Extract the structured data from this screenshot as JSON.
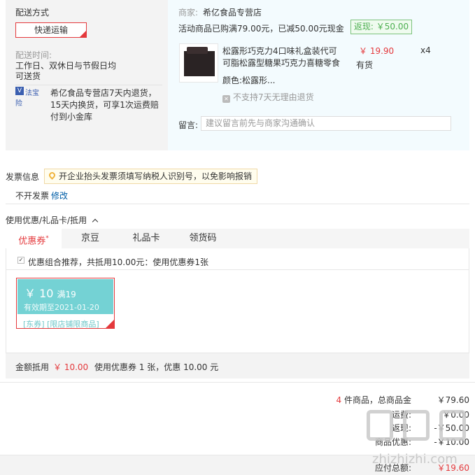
{
  "shipping": {
    "method_label": "配送方式",
    "method_option": "快递运输",
    "time_label": "配送时间:",
    "time_value_line1": "工作日、双休日与节假日均",
    "time_value_line2": "可送货",
    "insure_badge": "法宝险",
    "insure_line1": "希亿食品专营店7天内退货，",
    "insure_line2": "15天内换货，可享1次运费赔",
    "insure_line3": "付到小金库"
  },
  "store": {
    "merchant_label": "商家:",
    "merchant_name": "希亿食品专营店",
    "promo_text": "活动商品已购满79.00元，已减50.00元现金",
    "rebate_label": "返现:",
    "rebate_value": "￥50.00",
    "product": {
      "title_line1": "松露形巧克力4口味礼盒装代可",
      "title_line2": "可脂松露型糖果巧克力喜糖零食",
      "price": "￥ 19.90",
      "quantity": "x4",
      "stock": "有货",
      "color_label": "颜色:",
      "color_value": "松露形...",
      "no_return": "不支持7天无理由退货",
      "image_icon": "chocolate-gift-box-image"
    },
    "memo_label": "留言:",
    "memo_placeholder": "建议留言前先与商家沟通确认"
  },
  "invoice": {
    "label": "发票信息",
    "tip": "开企业抬头发票须填写纳税人识别号，以免影响报销",
    "status": "不开发票",
    "edit_link": "修改"
  },
  "coupons": {
    "section_title": "使用优惠/礼品卡/抵用",
    "tabs": [
      {
        "label": "优惠券",
        "mark": "*"
      },
      {
        "label": "京豆"
      },
      {
        "label": "礼品卡"
      },
      {
        "label": "领货码"
      }
    ],
    "combo_text": "优惠组合推荐，共抵用10.00元：使用优惠券1张",
    "coupon": {
      "amount": "￥ 10",
      "threshold": "满19",
      "valid": "有效期至2021-01-20",
      "tags": "[东券]  [限店铺限商品]"
    },
    "summary_label": "金额抵用",
    "summary_amount": "￥ 10.00",
    "summary_detail": "使用优惠券 1 张，优惠 10.00 元"
  },
  "totals": {
    "item_count": "4",
    "item_count_suffix": "件商品，总商品金",
    "goods_amount": "￥79.60",
    "shipping_label": "运费:",
    "shipping_amount": "￥0.00",
    "rebate_label": "返现:",
    "rebate_amount": "-￥50.00",
    "discount_label": "商品优惠:",
    "discount_amount": "-￥10.00",
    "payable_label": "应付总额:",
    "payable_amount": "￥19.60"
  },
  "watermark": {
    "text": "zhizhizhi.com"
  },
  "colors": {
    "accent_red": "#e4393c",
    "coupon_teal": "#74d2d4",
    "rebate_green": "#4caf50"
  }
}
